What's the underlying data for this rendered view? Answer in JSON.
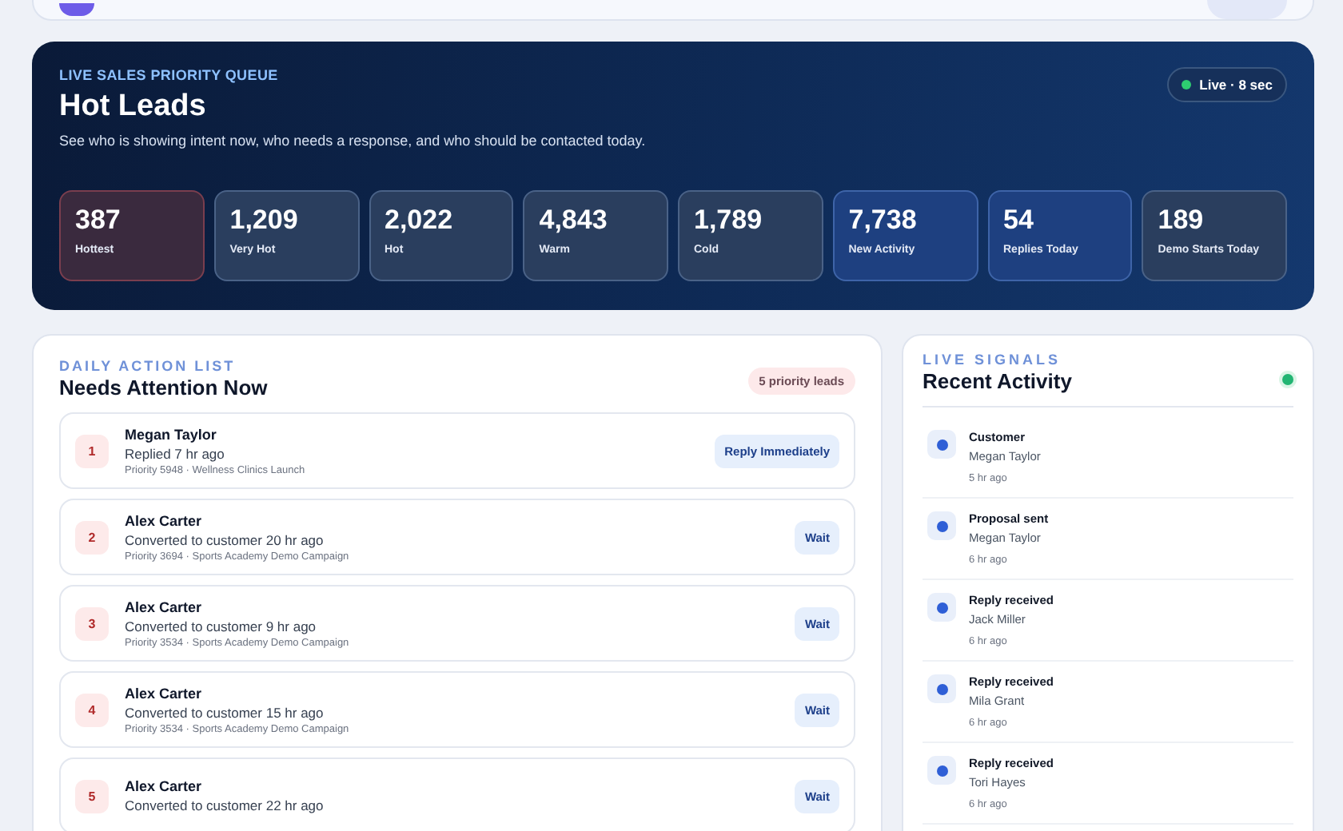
{
  "hero": {
    "eyebrow": "LIVE SALES PRIORITY QUEUE",
    "title": "Hot Leads",
    "subtitle": "See who is showing intent now, who needs a response, and who should be contacted today.",
    "live_badge": "Live · 8 sec",
    "stats": [
      {
        "value": "387",
        "label": "Hottest",
        "kind": "alert"
      },
      {
        "value": "1,209",
        "label": "Very Hot",
        "kind": "neutral"
      },
      {
        "value": "2,022",
        "label": "Hot",
        "kind": "neutral"
      },
      {
        "value": "4,843",
        "label": "Warm",
        "kind": "neutral"
      },
      {
        "value": "1,789",
        "label": "Cold",
        "kind": "neutral"
      },
      {
        "value": "7,738",
        "label": "New Activity",
        "kind": "accent"
      },
      {
        "value": "54",
        "label": "Replies Today",
        "kind": "accent"
      },
      {
        "value": "189",
        "label": "Demo Starts Today",
        "kind": "neutral"
      }
    ]
  },
  "action_list": {
    "eyebrow": "DAILY ACTION LIST",
    "title": "Needs Attention Now",
    "badge": "5 priority leads",
    "leads": [
      {
        "rank": "1",
        "name": "Megan Taylor",
        "event": "Replied 7 hr ago",
        "meta": "Priority 5948 · Wellness Clinics Launch",
        "action": "Reply Immediately"
      },
      {
        "rank": "2",
        "name": "Alex Carter",
        "event": "Converted to customer 20 hr ago",
        "meta": "Priority 3694 · Sports Academy Demo Campaign",
        "action": "Wait"
      },
      {
        "rank": "3",
        "name": "Alex Carter",
        "event": "Converted to customer 9 hr ago",
        "meta": "Priority 3534 · Sports Academy Demo Campaign",
        "action": "Wait"
      },
      {
        "rank": "4",
        "name": "Alex Carter",
        "event": "Converted to customer 15 hr ago",
        "meta": "Priority 3534 · Sports Academy Demo Campaign",
        "action": "Wait"
      },
      {
        "rank": "5",
        "name": "Alex Carter",
        "event": "Converted to customer 22 hr ago",
        "action": "Wait"
      }
    ]
  },
  "recent_activity": {
    "eyebrow": "LIVE SIGNALS",
    "title": "Recent Activity",
    "items": [
      {
        "title": "Customer",
        "name": "Megan Taylor",
        "time": "5 hr ago"
      },
      {
        "title": "Proposal sent",
        "name": "Megan Taylor",
        "time": "6 hr ago"
      },
      {
        "title": "Reply received",
        "name": "Jack Miller",
        "time": "6 hr ago"
      },
      {
        "title": "Reply received",
        "name": "Mila Grant",
        "time": "6 hr ago"
      },
      {
        "title": "Reply received",
        "name": "Tori Hayes",
        "time": "6 hr ago"
      }
    ]
  }
}
